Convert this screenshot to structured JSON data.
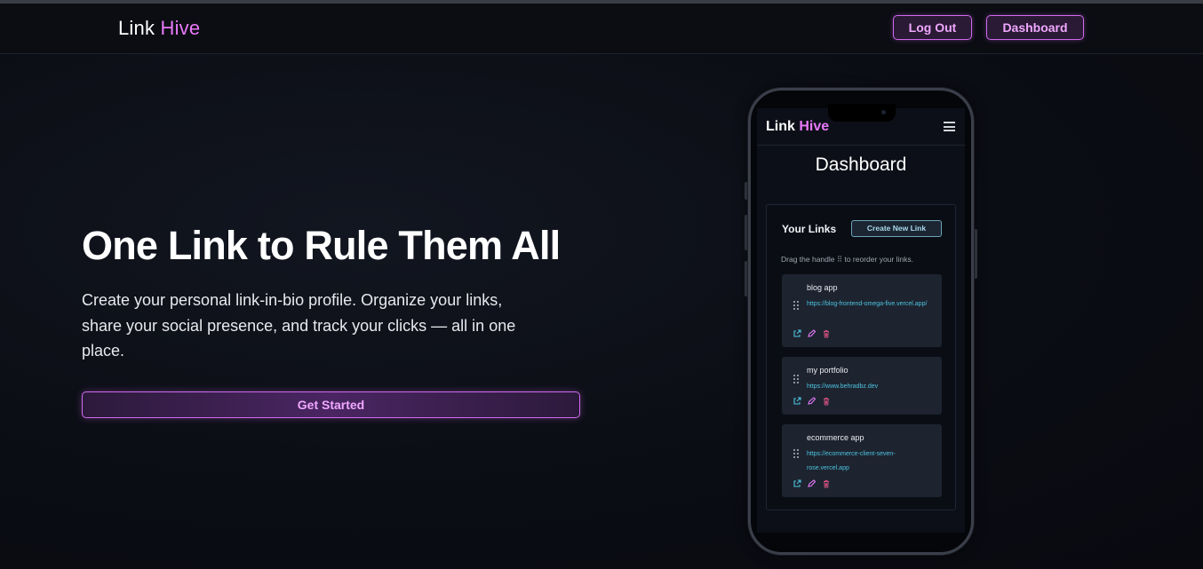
{
  "navbar": {
    "brand_part1": "Link",
    "brand_part2": "Hive",
    "logout_label": "Log Out",
    "dashboard_label": "Dashboard"
  },
  "hero": {
    "title": "One Link to Rule Them All",
    "subtitle": "Create your personal link-in-bio profile. Organize your links, share your social presence, and track your clicks — all in one place.",
    "cta_label": "Get Started"
  },
  "phone": {
    "brand_part1": "Link",
    "brand_part2": "Hive",
    "page_title": "Dashboard",
    "panel_title": "Your Links",
    "create_button": "Create New Link",
    "hint_before": "Drag the handle",
    "hint_handle": "⠿",
    "hint_after": "to reorder your links.",
    "links": [
      {
        "name": "blog app",
        "url": "https://blog-frontend-omega-five.vercel.app/"
      },
      {
        "name": "my portfolio",
        "url": "https://www.behradbz.dev"
      },
      {
        "name": "ecommerce app",
        "url": "https://ecommerce-client-seven-rose.vercel.app"
      }
    ]
  },
  "colors": {
    "accent": "#e879f9",
    "url": "#4ec3e0",
    "delete_icon": "#d0507f"
  },
  "icons": [
    "menu-icon",
    "drag-handle-icon",
    "external-link-icon",
    "edit-icon",
    "trash-icon"
  ]
}
